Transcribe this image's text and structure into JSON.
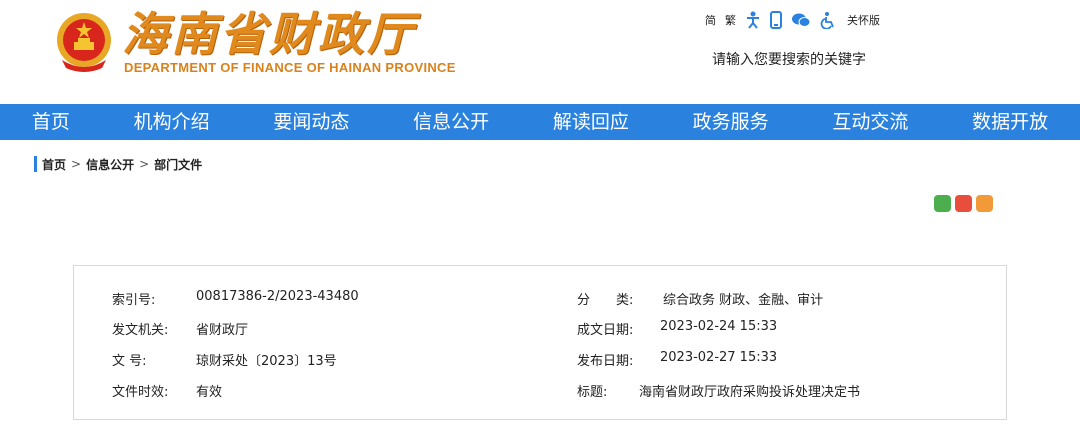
{
  "site": {
    "title_cn": "海南省财政厅",
    "title_en": "DEPARTMENT OF FINANCE OF HAINAN PROVINCE"
  },
  "toplinks": {
    "simplified": "简",
    "traditional": "繁",
    "care": "关怀版",
    "icons": [
      "accessibility-icon",
      "mobile-icon",
      "wechat-icon",
      "elder-care-icon"
    ]
  },
  "search": {
    "placeholder": "请输入您要搜索的关键字"
  },
  "nav": [
    "首页",
    "机构介绍",
    "要闻动态",
    "信息公开",
    "解读回应",
    "政务服务",
    "互动交流",
    "数据开放"
  ],
  "breadcrumb": [
    "首页",
    "信息公开",
    "部门文件"
  ],
  "share_colors": [
    "#4cae4c",
    "#e94e3c",
    "#f29a38"
  ],
  "info": {
    "index_label": "索引号:",
    "index_value": "00817386-2/2023-43480",
    "category_label": "分　　类:",
    "category_value": "综合政务 财政、金融、审计",
    "issuer_label": "发文机关:",
    "issuer_value": "省财政厅",
    "created_label": "成文日期:",
    "created_value": "2023-02-24 15:33",
    "docno_label": "文 号:",
    "docno_value": "琼财采处〔2023〕13号",
    "published_label": "发布日期:",
    "published_value": "2023-02-27 15:33",
    "validity_label": "文件时效:",
    "validity_value": "有效",
    "title_label": "标题:",
    "title_value": "海南省财政厅政府采购投诉处理决定书"
  }
}
